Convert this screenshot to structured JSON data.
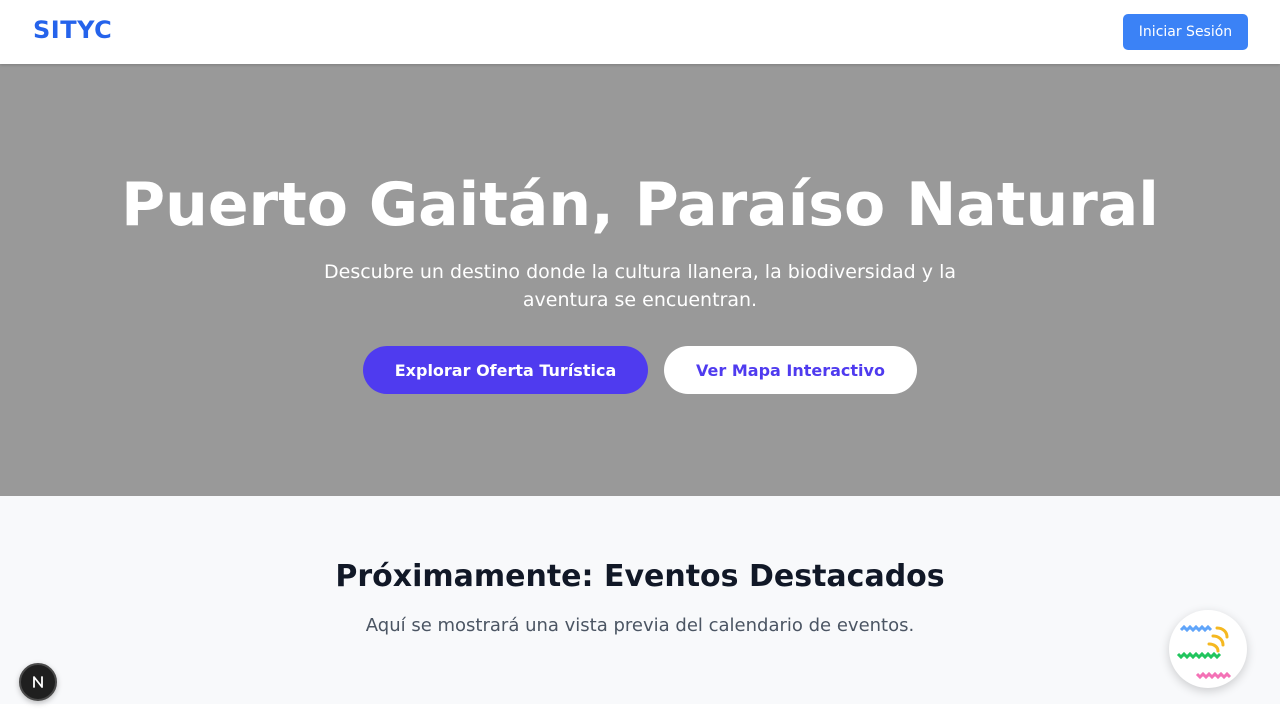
{
  "navbar": {
    "brand": "SITYC",
    "login_label": "Iniciar Sesión"
  },
  "hero": {
    "title": "Puerto Gaitán, Paraíso Natural",
    "subtitle": "Descubre un destino donde la cultura llanera, la biodiversidad y la aventura se encuentran.",
    "primary_cta": "Explorar Oferta Turística",
    "secondary_cta": "Ver Mapa Interactivo"
  },
  "events": {
    "title": "Próximamente: Eventos Destacados",
    "subtitle": "Aquí se mostrará una vista previa del calendario de eventos."
  },
  "colors": {
    "brand": "#2563eb",
    "login_button": "#3b82f6",
    "hero_bg": "#999999",
    "cta_primary": "#4f3bef"
  },
  "icons": {
    "dev_badge": "nextjs-logo-icon",
    "chat_widget": "chat-assistant-icon"
  }
}
